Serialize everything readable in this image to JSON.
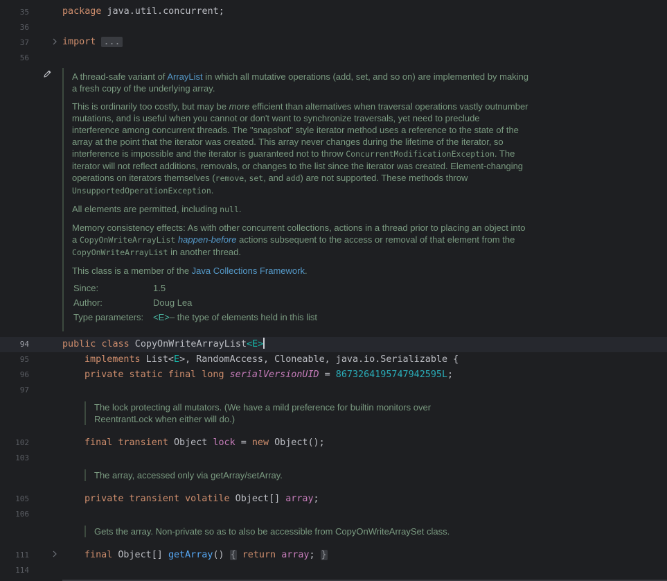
{
  "gutter": {
    "line_numbers": [
      "35",
      "36",
      "37",
      "56",
      "94",
      "95",
      "96",
      "97",
      "102",
      "103",
      "105",
      "106",
      "111",
      "114"
    ]
  },
  "code": {
    "l35_kw": "package",
    "l35_rest": " java.util.concurrent;",
    "l37_kw": "import",
    "l37_fold": "...",
    "l94_kw1": "public",
    "l94_kw2": "class",
    "l94_name": " CopyOnWriteArrayList",
    "l94_lt": "<",
    "l94_e": "E",
    "l94_gt": ">",
    "l95_kw": "implements",
    "l95_rest1": " List<",
    "l95_e": "E",
    "l95_rest2": ">, RandomAccess, Cloneable, java.io.Serializable {",
    "l96_kw": "private static final long",
    "l96_field": "serialVersionUID",
    "l96_eq": " = ",
    "l96_num": "8673264195747942595L",
    "l96_semi": ";",
    "l102_kw": "final transient",
    "l102_type": " Object ",
    "l102_field": "lock",
    "l102_eq": " = ",
    "l102_new": "new",
    "l102_rest": " Object();",
    "l105_kw": "private transient volatile",
    "l105_type": " Object[] ",
    "l105_field": "array",
    "l105_semi": ";",
    "l111_kw": "final",
    "l111_type": " Object[] ",
    "l111_fn": "getArray",
    "l111_paren": "() ",
    "l111_open": "{",
    "l111_ret": " return ",
    "l111_field": "array",
    "l111_semi": "; ",
    "l111_close": "}"
  },
  "doc_main": {
    "p1_a": "A thread-safe variant of ",
    "p1_link": "ArrayList",
    "p1_b": " in which all mutative operations (add, set, and so on) are implemented by making a fresh copy of the underlying array.",
    "p2_a": "This is ordinarily too costly, but may be ",
    "p2_it": "more",
    "p2_b": " efficient than alternatives when traversal operations vastly outnumber mutations, and is useful when you cannot or don't want to synchronize traversals, yet need to preclude interference among concurrent threads. The \"snapshot\" style iterator method uses a reference to the state of the array at the point that the iterator was created. This array never changes during the lifetime of the iterator, so interference is impossible and the iterator is guaranteed not to throw ",
    "p2_code1": "ConcurrentModificationException",
    "p2_c": ". The iterator will not reflect additions, removals, or changes to the list since the iterator was created. Element-changing operations on iterators themselves (",
    "p2_code2": "remove",
    "p2_d": ", ",
    "p2_code3": "set",
    "p2_e": ", and ",
    "p2_code4": "add",
    "p2_f": ") are not supported. These methods throw ",
    "p2_code5": "UnsupportedOperationException",
    "p2_g": ".",
    "p3_a": "All elements are permitted, including ",
    "p3_code": "null",
    "p3_b": ".",
    "p4_a": "Memory consistency effects: As with other concurrent collections, actions in a thread prior to placing an object into a ",
    "p4_code1": "CopyOnWriteArrayList",
    "p4_sp": " ",
    "p4_it": "happen-before",
    "p4_b": " actions subsequent to the access or removal of that element from the ",
    "p4_code2": "CopyOnWriteArrayList",
    "p4_c": " in another thread.",
    "p5_a": "This class is a member of the ",
    "p5_link": "Java Collections Framework",
    "p5_b": ".",
    "since_k": "Since:",
    "since_v": "1.5",
    "author_k": "Author:",
    "author_v": "Doug Lea",
    "type_k": "Type parameters:",
    "type_e": "<E>",
    "type_v": " – the type of elements held in this list"
  },
  "doc_lock": "The lock protecting all mutators. (We have a mild preference for builtin monitors over ReentrantLock when either will do.)",
  "doc_array": "The array, accessed only via getArray/setArray.",
  "doc_getarray": "Gets the array. Non-private so as to also be accessible from CopyOnWriteArraySet class.",
  "colors": {
    "background": "#1e1f22",
    "keyword": "#cf8e6d",
    "number": "#2aacb8",
    "field": "#c77dbb",
    "function": "#56a8f5",
    "doc_text": "#7a9a80",
    "doc_link": "#5599c8"
  },
  "icons": [
    "pencil-icon",
    "fold-arrow-icon"
  ]
}
